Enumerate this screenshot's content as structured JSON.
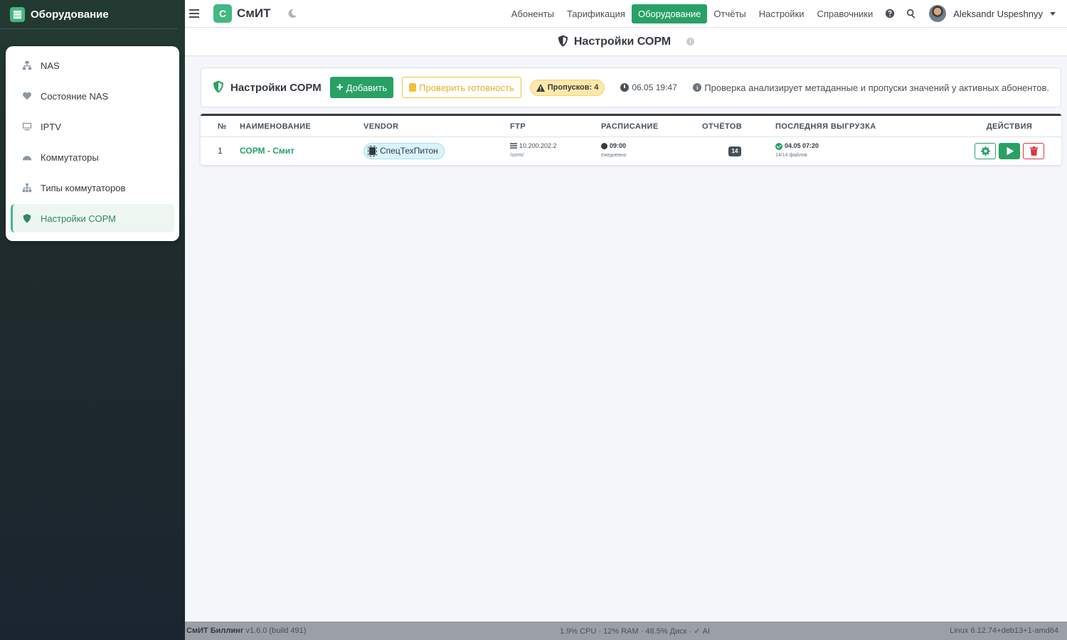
{
  "sidebar": {
    "title": "Оборудование",
    "items": [
      {
        "label": "NAS",
        "icon": "network-icon"
      },
      {
        "label": "Состояние NAS",
        "icon": "heartbeat-icon"
      },
      {
        "label": "IPTV",
        "icon": "tv-icon"
      },
      {
        "label": "Коммутаторы",
        "icon": "switch-icon"
      },
      {
        "label": "Типы коммутаторов",
        "icon": "sitemap-icon"
      },
      {
        "label": "Настройки СОРМ",
        "icon": "shield-icon",
        "active": true
      }
    ]
  },
  "topbar": {
    "logo_letter": "С",
    "logo_text": "СмИТ",
    "menu": [
      "Абоненты",
      "Тарификация",
      "Оборудование",
      "Отчёты",
      "Настройки",
      "Справочники"
    ],
    "active_menu": "Оборудование",
    "user_name": "Aleksandr Uspeshnyy"
  },
  "page_header": {
    "title": "Настройки СОРМ"
  },
  "toolbar": {
    "title": "Настройки СОРМ",
    "add_label": "Добавить",
    "check_label": "Проверить готовность",
    "warn_label": "Пропусков: 4",
    "timestamp": "06.05 19:47",
    "note": "Проверка анализирует метаданные и пропуски значений у активных абонентов."
  },
  "table": {
    "headers": [
      "№",
      "НАИМЕНОВАНИЕ",
      "VENDOR",
      "FTP",
      "РАСПИСАНИЕ",
      "ОТЧЁТОВ",
      "ПОСЛЕДНЯЯ ВЫГРУЗКА",
      "ДЕЙСТВИЯ"
    ],
    "rows": [
      {
        "num": "1",
        "name": "СОРМ - Смит",
        "vendor": "СпецТехПитон",
        "ftp_host": "10.200.202.2",
        "ftp_path": "/sorm/",
        "schedule_time": "09:00",
        "schedule_freq": "ежедневно",
        "reports": "14",
        "last_upload": "04.05 07:20",
        "last_upload_files": "14/14 файлов"
      }
    ]
  },
  "footer": {
    "app": "СмИТ Биллинг",
    "version": "v1.6.0 (build 491)",
    "stats": "1.9% CPU · 12% RAM · 48.5% Диск · ✓ AI",
    "os": "Linux 6.12.74+deb13+1-amd64"
  },
  "colors": {
    "accent": "#28a165",
    "brand": "#42b883",
    "danger": "#dc3545",
    "warning": "#f0c23a"
  }
}
